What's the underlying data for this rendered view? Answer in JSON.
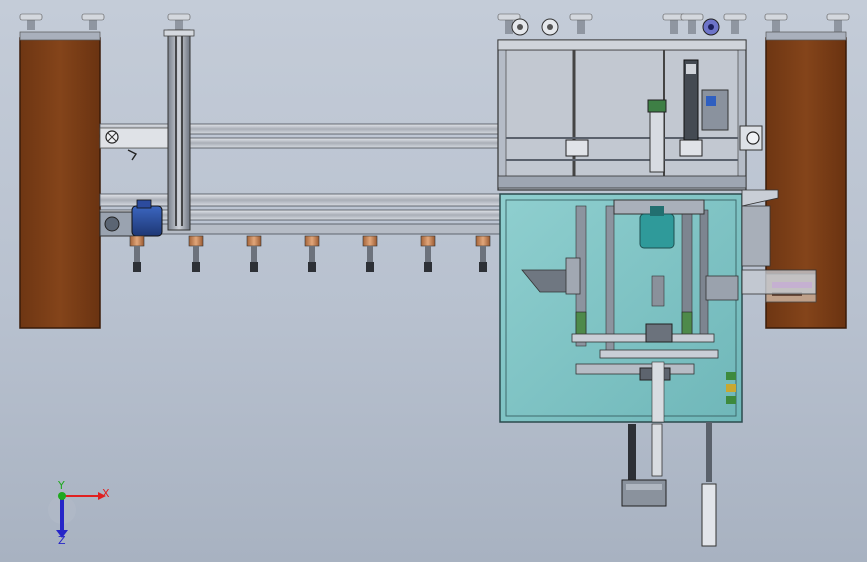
{
  "window": {
    "title": ""
  },
  "scene": {
    "view": "top",
    "colors": {
      "background_top": "#c4ccd8",
      "background_bottom": "#a8b2c1",
      "wood_panel": "#7b3e17",
      "wood_edge": "#3a1b08",
      "rail": "#c9ced6",
      "frame": "#a9b0bc",
      "glass_enclosure": "#7fc3c3",
      "motor": "#2b4d9a",
      "column_green": "#4e8a4a",
      "copper_nozzle": "#c28456"
    },
    "components": [
      "left-wood-panel",
      "right-wood-panel",
      "vertical-gantry-column",
      "upper-rail-pair",
      "lower-rail-pair",
      "drive-motor",
      "nozzle-row",
      "upper-machine-frame",
      "glass-enclosure",
      "lower-actuator",
      "leveling-feet"
    ],
    "nozzle_count": 7
  },
  "triad": {
    "x_label": "X",
    "y_label": "Y",
    "z_label": "Z",
    "x_color": "#e02020",
    "y_color": "#1fa81f",
    "z_color": "#2626c8"
  }
}
